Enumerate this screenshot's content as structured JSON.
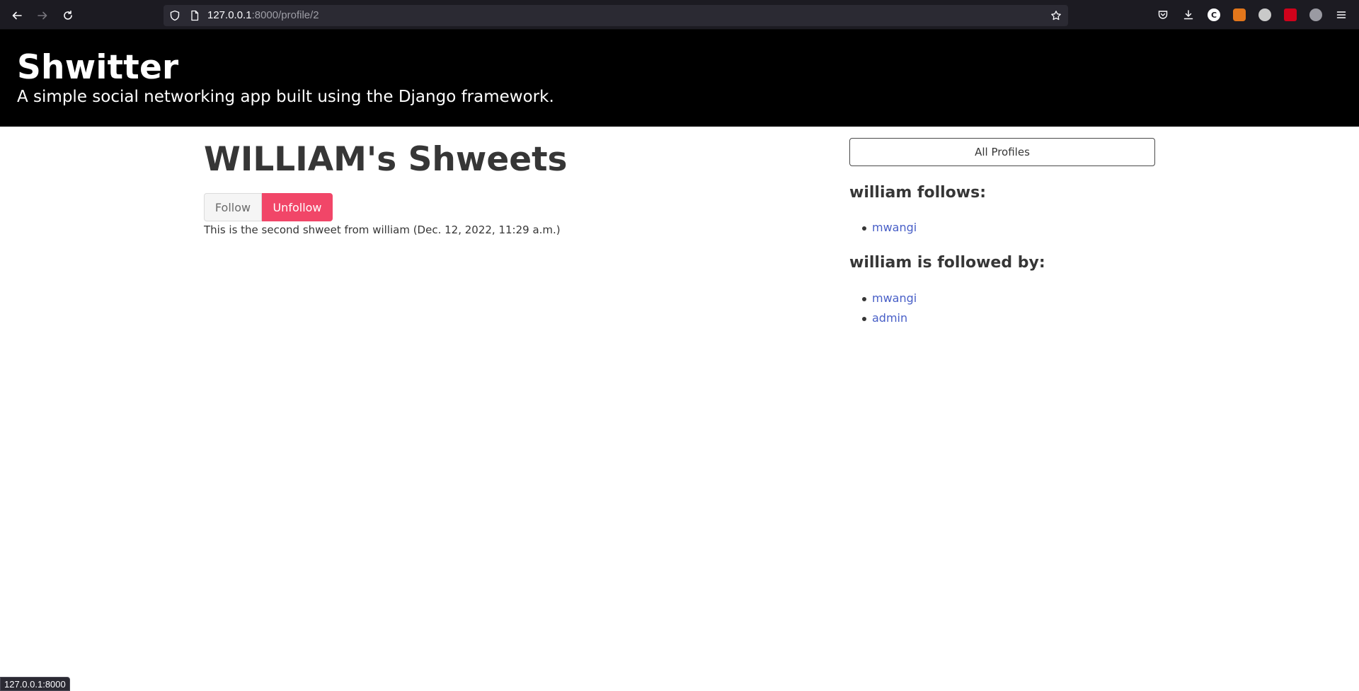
{
  "browser": {
    "url_host": "127.0.0.1",
    "url_rest": ":8000/profile/2",
    "status_text": "127.0.0.1:8000",
    "extensions": [
      {
        "name": "pocket-icon"
      },
      {
        "name": "download-icon"
      },
      {
        "name": "c-extension-icon",
        "glyph": "C"
      },
      {
        "name": "metamask-icon"
      },
      {
        "name": "robot-extension-icon"
      },
      {
        "name": "red-extension-icon"
      },
      {
        "name": "grey-extension-icon"
      },
      {
        "name": "hamburger-menu-icon"
      }
    ]
  },
  "hero": {
    "title": "Shwitter",
    "subtitle": "A simple social networking app built using the Django framework."
  },
  "main": {
    "title": "WILLIAM's Shweets",
    "follow_label": "Follow",
    "unfollow_label": "Unfollow",
    "shweets": [
      "This is the second shweet from william (Dec. 12, 2022, 11:29 a.m.)"
    ]
  },
  "sidebar": {
    "all_profiles_label": "All Profiles",
    "follows_heading": "william follows:",
    "follows": [
      "mwangi"
    ],
    "followed_by_heading": "william is followed by:",
    "followed_by": [
      "mwangi",
      "admin"
    ]
  },
  "colors": {
    "hero_bg": "#000000",
    "unfollow_bg": "#f14668",
    "link": "#485fc7",
    "text": "#363636"
  }
}
